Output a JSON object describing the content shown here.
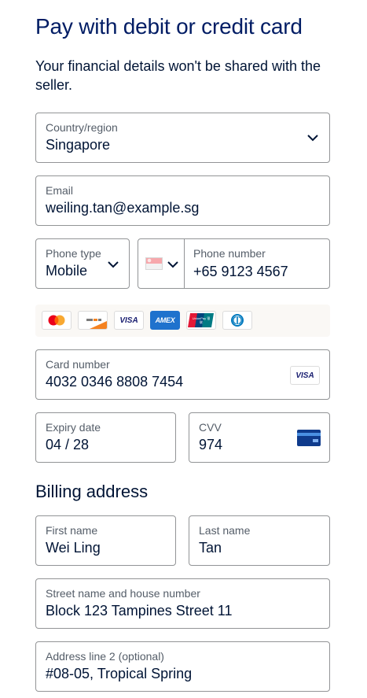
{
  "header": {
    "title": "Pay with debit or credit card",
    "subtitle": "Your financial details won't be shared with the seller."
  },
  "country": {
    "label": "Country/region",
    "value": "Singapore"
  },
  "email": {
    "label": "Email",
    "value": "weiling.tan@example.sg"
  },
  "phone_type": {
    "label": "Phone type",
    "value": "Mobile"
  },
  "phone_country": {
    "flag": "singapore-flag-icon"
  },
  "phone_number": {
    "label": "Phone number",
    "value": "+65 9123 4567"
  },
  "accepted_cards": {
    "visa_text": "VISA",
    "amex_text": "AMEX",
    "unionpay_text": "UnionPay 银联"
  },
  "card_number": {
    "label": "Card number",
    "value": "4032 0346 8808 7454",
    "brand_text": "VISA"
  },
  "expiry": {
    "label": "Expiry date",
    "value": "04 / 28"
  },
  "cvv": {
    "label": "CVV",
    "value": "974"
  },
  "billing": {
    "title": "Billing address",
    "first_name": {
      "label": "First name",
      "value": "Wei Ling"
    },
    "last_name": {
      "label": "Last name",
      "value": "Tan"
    },
    "street": {
      "label": "Street name and house number",
      "value": "Block 123 Tampines Street 11"
    },
    "address2": {
      "label": "Address line 2 (optional)",
      "value": "#08-05, Tropical Spring"
    }
  },
  "colors": {
    "heading": "#001c64",
    "text": "#001435",
    "label": "#545d68",
    "border": "#929496",
    "strip_bg": "#faf8f5",
    "visa_blue": "#1a1f71",
    "amex_blue": "#1f72cd"
  }
}
